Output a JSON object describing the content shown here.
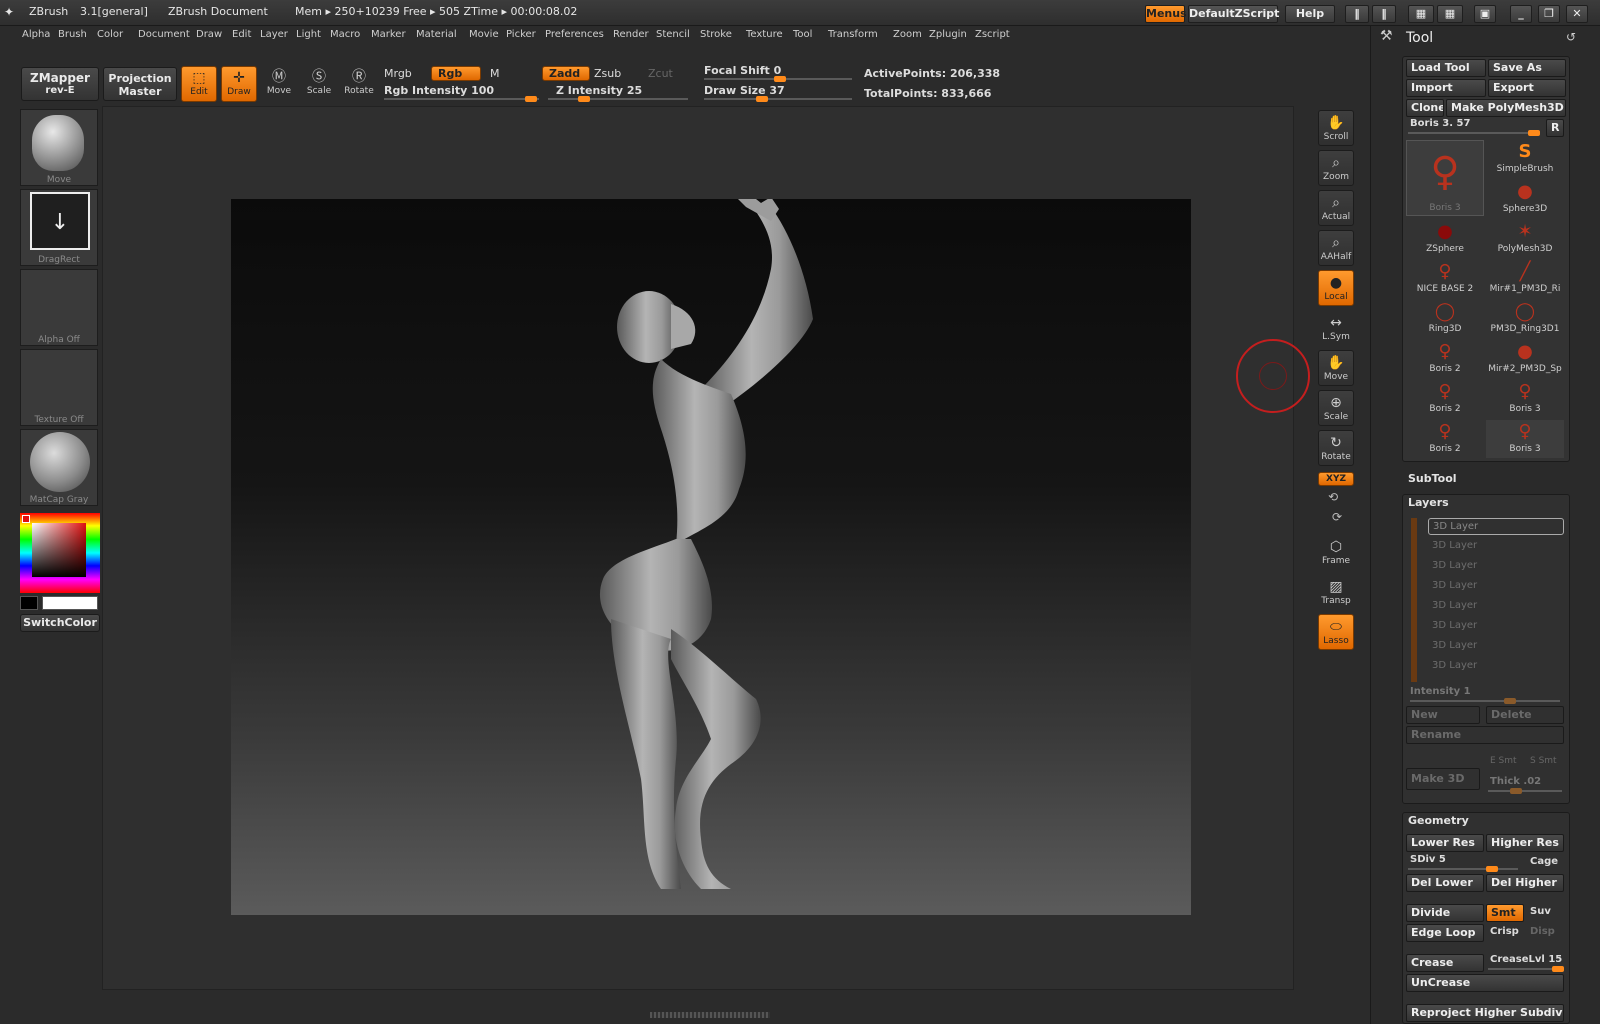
{
  "title_bar": {
    "app": "ZBrush",
    "version": "3.1[general]",
    "document": "ZBrush Document",
    "stats": "Mem ▸ 250+10239  Free ▸ 505  ZTime ▸ 00:00:08.02",
    "menus_label": "Menus",
    "script_label": "DefaultZScript",
    "help_label": "Help"
  },
  "menu": [
    "Alpha",
    "Brush",
    "Color",
    "Document",
    "Draw",
    "Edit",
    "Layer",
    "Light",
    "Macro",
    "Marker",
    "Material",
    "Movie",
    "Picker",
    "Preferences",
    "Render",
    "Stencil",
    "Stroke",
    "Texture",
    "Tool",
    "Transform",
    "Zoom",
    "Zplugin",
    "Zscript"
  ],
  "shelf": {
    "zmapper": "ZMapper",
    "zmapper_sub": "rev-E",
    "projection": "Projection",
    "projection_sub": "Master",
    "edit": "Edit",
    "draw": "Draw",
    "move": "Move",
    "scale": "Scale",
    "rotate": "Rotate",
    "mrgb": "Mrgb",
    "rgb": "Rgb",
    "m": "M",
    "rgb_intensity": "Rgb Intensity 100",
    "zadd": "Zadd",
    "zsub": "Zsub",
    "zcut": "Zcut",
    "z_intensity": "Z Intensity 25",
    "focal_shift": "Focal Shift 0",
    "draw_size": "Draw Size 37",
    "active_points": "ActivePoints: 206,338",
    "total_points": "TotalPoints: 833,666"
  },
  "left_panel": {
    "brush": "Move",
    "stroke": "DragRect",
    "alpha": "Alpha Off",
    "texture": "Texture Off",
    "material": "MatCap Gray",
    "switch_color": "SwitchColor"
  },
  "right_toolbar": [
    "Scroll",
    "Zoom",
    "Actual",
    "AAHalf",
    "Local",
    "L.Sym",
    "Move",
    "Scale",
    "Rotate",
    "XYZ",
    "Frame",
    "Transp",
    "Lasso"
  ],
  "tool_palette": {
    "title": "Tool",
    "load_tool": "Load Tool",
    "save_as": "Save As",
    "import": "Import",
    "export": "Export",
    "clone": "Clone",
    "make_polymesh": "Make PolyMesh3D",
    "current_tool": "Boris 3. 57",
    "r": "R",
    "tools": [
      "Boris 3",
      "SimpleBrush",
      "Sphere3D",
      "ZSphere",
      "PolyMesh3D",
      "NICE BASE 2",
      "Mir#1_PM3D_Ri",
      "Ring3D",
      "PM3D_Ring3D1",
      "Boris 2",
      "Mir#2_PM3D_Sp",
      "Boris 2",
      "Boris 3",
      "Boris 2",
      "Boris 3"
    ],
    "subtool": "SubTool",
    "layers": "Layers",
    "layer_items": [
      "3D Layer",
      "3D Layer",
      "3D Layer",
      "3D Layer",
      "3D Layer",
      "3D Layer",
      "3D Layer",
      "3D Layer"
    ],
    "intensity": "Intensity 1",
    "new": "New",
    "delete": "Delete",
    "rename": "Rename",
    "make_3d": "Make 3D",
    "e_smt": "E Smt",
    "s_smt": "S Smt",
    "thick": "Thick .02",
    "geometry": "Geometry",
    "lower_res": "Lower Res",
    "higher_res": "Higher Res",
    "sdiv": "SDiv 5",
    "cage": "Cage",
    "del_lower": "Del Lower",
    "del_higher": "Del Higher",
    "divide": "Divide",
    "smt": "Smt",
    "suv": "Suv",
    "edge_loop": "Edge Loop",
    "crisp": "Crisp",
    "disp": "Disp",
    "crease": "Crease",
    "crease_lvl": "CreaseLvl 15",
    "uncrease": "UnCrease",
    "reproject": "Reproject Higher Subdiv"
  },
  "colors": {
    "accent": "#ff8a1a",
    "panel": "#2a2a2a",
    "brush_ring": "#c41e1e"
  }
}
